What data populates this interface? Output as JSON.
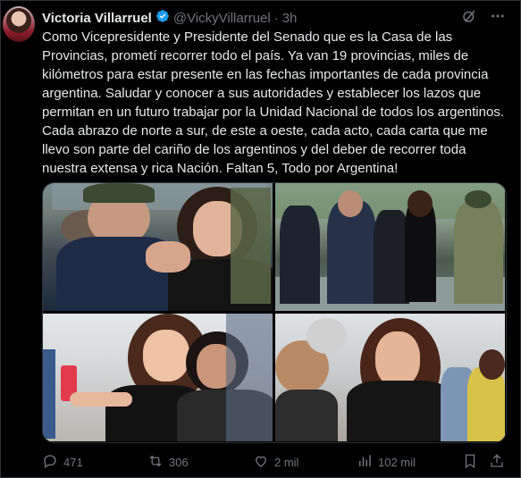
{
  "tweet": {
    "author_name": "Victoria Villarruel",
    "handle": "@VickyVillarruel",
    "separator": "·",
    "time": "3h",
    "body": "Como Vicepresidente y Presidente del Senado que es la Casa de las Provincias, prometí recorrer todo el país. Ya van 19 provincias, miles de kilómetros para estar presente en las fechas importantes de cada provincia argentina. Saludar y conocer a sus autoridades y establecer los lazos que permitan en un futuro trabajar por la Unidad Nacional de todos los argentinos. Cada abrazo de norte a sur, de este a oeste, cada acto, cada carta que me llevo son parte del cariño de los argentinos y del deber de recorrer toda nuestra extensa y rica Nación. Faltan 5, Todo por Argentina!"
  },
  "actions": {
    "replies": "471",
    "reposts": "306",
    "likes": "2 mil",
    "views": "102 mil"
  },
  "icons": {
    "verified": "verified-badge-icon",
    "grok": "grok-icon",
    "more": "more-icon",
    "reply": "reply-icon",
    "repost": "repost-icon",
    "like": "like-icon",
    "views": "views-icon",
    "bookmark": "bookmark-icon",
    "share": "share-icon"
  },
  "colors": {
    "background": "#000000",
    "text": "#e7e9ea",
    "muted": "#71767b",
    "verified": "#1d9bf0"
  }
}
